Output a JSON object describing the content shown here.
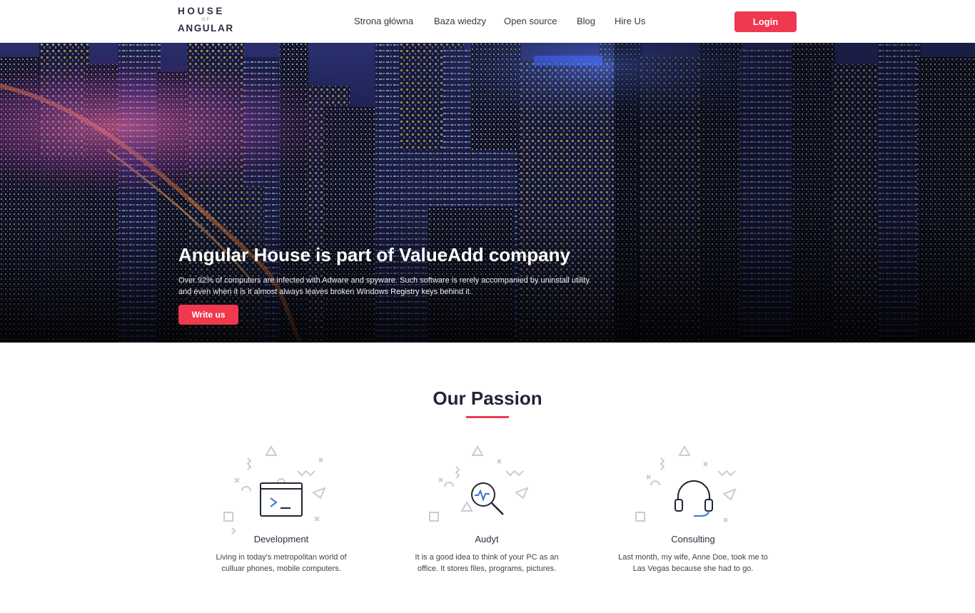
{
  "header": {
    "logo": {
      "line1": "HOUSE",
      "line2": "OF",
      "line3": "ANGULAR"
    },
    "nav": [
      {
        "label": "Strona główna"
      },
      {
        "label": "Baza wiedzy"
      },
      {
        "label": "Open source"
      },
      {
        "label": "Blog"
      },
      {
        "label": "Hire Us"
      }
    ],
    "login_label": "Login"
  },
  "hero": {
    "title": "Angular House is part of ValueAdd company",
    "text_line1": "Over 92% of computers are infected with Adware and spyware. Such software is rerely accompanied by uninstall utility",
    "text_line2": "and even when it is it almost always leaves broken Windows Registry keys behind it.",
    "button_label": "Write us"
  },
  "passion": {
    "title": "Our Passion",
    "cards": [
      {
        "name": "Development",
        "icon": "terminal-icon",
        "desc_line1": "Living in today's metropolitan world of",
        "desc_line2": "culluar phones, mobile computers."
      },
      {
        "name": "Audyt",
        "icon": "magnifier-pulse-icon",
        "desc_line1": "It is a good idea to think of your PC as an",
        "desc_line2": "office. It stores files, programs, pictures."
      },
      {
        "name": "Consulting",
        "icon": "headset-icon",
        "desc_line1": "Last month, my wife, Anne Doe, took me to",
        "desc_line2": "Las Vegas because she had to go."
      }
    ]
  },
  "colors": {
    "accent": "#f0384e",
    "text": "#1f2533",
    "icon_blue": "#3b73d1"
  }
}
